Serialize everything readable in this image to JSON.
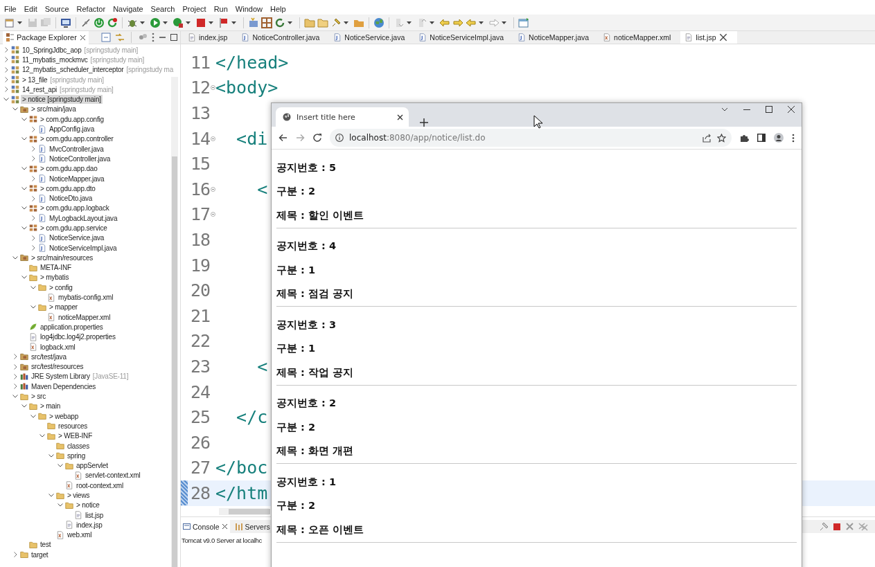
{
  "menu": [
    "File",
    "Edit",
    "Source",
    "Refactor",
    "Navigate",
    "Search",
    "Project",
    "Run",
    "Window",
    "Help"
  ],
  "package_explorer": {
    "title": "Package Explorer",
    "items": [
      {
        "label": "10_SpringJdbc_aop",
        "tag": "[springstudy main]",
        "kind": "project",
        "expanded": false,
        "selected": false
      },
      {
        "label": "11_mybatis_mockmvc",
        "tag": "[springstudy main]",
        "kind": "project",
        "expanded": false,
        "selected": false
      },
      {
        "label": "12_mybatis_scheduler_interceptor",
        "tag": "[springstudy ma",
        "kind": "project",
        "expanded": false,
        "selected": false
      },
      {
        "label": "> 13_file",
        "tag": "[springstudy main]",
        "kind": "project",
        "expanded": false,
        "selected": false
      },
      {
        "label": "14_rest_api",
        "tag": "[springstudy main]",
        "kind": "project",
        "expanded": false,
        "selected": false
      },
      {
        "label": "> notice [springstudy main]",
        "kind": "project",
        "expanded": true,
        "selected": true,
        "children": [
          {
            "label": "> src/main/java",
            "kind": "srcfolder",
            "expanded": true,
            "selected": false,
            "children": [
              {
                "label": "> com.gdu.app.config",
                "kind": "package",
                "expanded": true,
                "selected": false,
                "children": [
                  {
                    "label": "AppConfig.java",
                    "kind": "java",
                    "expanded": false,
                    "selected": false
                  }
                ]
              },
              {
                "label": "> com.gdu.app.controller",
                "kind": "package",
                "expanded": true,
                "selected": false,
                "children": [
                  {
                    "label": "MvcController.java",
                    "kind": "java",
                    "expanded": false,
                    "selected": false
                  },
                  {
                    "label": "NoticeController.java",
                    "kind": "java",
                    "expanded": false,
                    "selected": false
                  }
                ]
              },
              {
                "label": "> com.gdu.app.dao",
                "kind": "package",
                "expanded": true,
                "selected": false,
                "children": [
                  {
                    "label": "NoticeMapper.java",
                    "kind": "java",
                    "expanded": false,
                    "selected": false
                  }
                ]
              },
              {
                "label": "> com.gdu.app.dto",
                "kind": "package",
                "expanded": true,
                "selected": false,
                "children": [
                  {
                    "label": "NoticeDto.java",
                    "kind": "java",
                    "expanded": false,
                    "selected": false
                  }
                ]
              },
              {
                "label": "> com.gdu.app.logback",
                "kind": "package",
                "expanded": true,
                "selected": false,
                "children": [
                  {
                    "label": "MyLogbackLayout.java",
                    "kind": "java",
                    "expanded": false,
                    "selected": false
                  }
                ]
              },
              {
                "label": "> com.gdu.app.service",
                "kind": "package",
                "expanded": true,
                "selected": false,
                "children": [
                  {
                    "label": "NoticeService.java",
                    "kind": "java",
                    "expanded": false,
                    "selected": false
                  },
                  {
                    "label": "NoticeServiceImpl.java",
                    "kind": "java",
                    "expanded": false,
                    "selected": false
                  }
                ]
              }
            ]
          },
          {
            "label": "> src/main/resources",
            "kind": "srcfolder",
            "expanded": true,
            "selected": false,
            "children": [
              {
                "label": "META-INF",
                "kind": "folder",
                "selected": false
              },
              {
                "label": "> mybatis",
                "kind": "folder",
                "expanded": true,
                "selected": false,
                "children": [
                  {
                    "label": "> config",
                    "kind": "folder",
                    "expanded": true,
                    "selected": false,
                    "children": [
                      {
                        "label": "mybatis-config.xml",
                        "kind": "xml",
                        "selected": false
                      }
                    ]
                  },
                  {
                    "label": "> mapper",
                    "kind": "folder",
                    "expanded": true,
                    "selected": false,
                    "children": [
                      {
                        "label": "noticeMapper.xml",
                        "kind": "xml",
                        "selected": false
                      }
                    ]
                  }
                ]
              },
              {
                "label": "application.properties",
                "kind": "properties",
                "selected": false
              },
              {
                "label": "log4jdbc.log4j2.properties",
                "kind": "file",
                "selected": false
              },
              {
                "label": "logback.xml",
                "kind": "xml",
                "selected": false
              }
            ]
          },
          {
            "label": "src/test/java",
            "kind": "srcfolder",
            "expanded": false,
            "selected": false
          },
          {
            "label": "src/test/resources",
            "kind": "srcfolder",
            "expanded": false,
            "selected": false
          },
          {
            "label": "JRE System Library",
            "tag": "[JavaSE-11]",
            "kind": "library",
            "expanded": false,
            "selected": false
          },
          {
            "label": "Maven Dependencies",
            "kind": "library",
            "expanded": false,
            "selected": false
          },
          {
            "label": "> src",
            "kind": "folder",
            "expanded": true,
            "selected": false,
            "children": [
              {
                "label": "> main",
                "kind": "folder",
                "expanded": true,
                "selected": false,
                "children": [
                  {
                    "label": "> webapp",
                    "kind": "folder",
                    "expanded": true,
                    "selected": false,
                    "children": [
                      {
                        "label": "resources",
                        "kind": "folder",
                        "selected": false
                      },
                      {
                        "label": "> WEB-INF",
                        "kind": "folder",
                        "expanded": true,
                        "selected": false,
                        "children": [
                          {
                            "label": "classes",
                            "kind": "folder",
                            "selected": false
                          },
                          {
                            "label": "spring",
                            "kind": "folder",
                            "expanded": true,
                            "selected": false,
                            "children": [
                              {
                                "label": "appServlet",
                                "kind": "folder",
                                "expanded": true,
                                "selected": false,
                                "children": [
                                  {
                                    "label": "servlet-context.xml",
                                    "kind": "xml",
                                    "selected": false
                                  }
                                ]
                              },
                              {
                                "label": "root-context.xml",
                                "kind": "xml",
                                "selected": false
                              }
                            ]
                          },
                          {
                            "label": "> views",
                            "kind": "folder",
                            "expanded": true,
                            "selected": false,
                            "children": [
                              {
                                "label": "> notice",
                                "kind": "folder",
                                "expanded": true,
                                "selected": false,
                                "children": [
                                  {
                                    "label": "list.jsp",
                                    "kind": "file",
                                    "selected": false
                                  }
                                ]
                              },
                              {
                                "label": "index.jsp",
                                "kind": "file",
                                "selected": false
                              }
                            ]
                          },
                          {
                            "label": "web.xml",
                            "kind": "xml",
                            "selected": false
                          }
                        ]
                      }
                    ]
                  }
                ]
              },
              {
                "label": "test",
                "kind": "folder",
                "selected": false
              }
            ]
          },
          {
            "label": "target",
            "kind": "folder",
            "expanded": false,
            "selected": false
          }
        ]
      }
    ]
  },
  "editor": {
    "tabs": [
      {
        "label": "index.jsp",
        "kind": "file",
        "selected": false
      },
      {
        "label": "NoticeController.java",
        "kind": "java",
        "selected": false
      },
      {
        "label": "NoticeService.java",
        "kind": "java",
        "selected": false
      },
      {
        "label": "NoticeServiceImpl.java",
        "kind": "java",
        "selected": false
      },
      {
        "label": "NoticeMapper.java",
        "kind": "java",
        "selected": false
      },
      {
        "label": "noticeMapper.xml",
        "kind": "xml",
        "selected": false
      },
      {
        "label": "list.jsp",
        "kind": "file",
        "selected": true
      }
    ],
    "lines": [
      {
        "number": "11",
        "code": "</head>",
        "fold": false,
        "current": false
      },
      {
        "number": "12",
        "code": "<body>",
        "fold": true,
        "current": false
      },
      {
        "number": "13",
        "fold": false,
        "current": false
      },
      {
        "number": "14",
        "code": "  <di",
        "fold": true,
        "current": false
      },
      {
        "number": "15",
        "fold": false,
        "current": false
      },
      {
        "number": "16",
        "code": "    <",
        "fold": true,
        "current": false
      },
      {
        "number": "17",
        "fold": true,
        "current": false
      },
      {
        "number": "18",
        "fold": false,
        "current": false
      },
      {
        "number": "19",
        "fold": false,
        "current": false
      },
      {
        "number": "20",
        "fold": false,
        "current": false
      },
      {
        "number": "21",
        "fold": false,
        "current": false
      },
      {
        "number": "22",
        "fold": false,
        "current": false
      },
      {
        "number": "23",
        "code": "    <",
        "fold": false,
        "current": false
      },
      {
        "number": "24",
        "fold": false,
        "current": false
      },
      {
        "number": "25",
        "code": "  </c",
        "fold": false,
        "current": false
      },
      {
        "number": "26",
        "fold": false,
        "current": false
      },
      {
        "number": "27",
        "code": "</boc",
        "fold": false,
        "current": false
      },
      {
        "number": "28",
        "code": "</htm",
        "fold": false,
        "current": true
      }
    ]
  },
  "bottom_panel": {
    "tabs": [
      {
        "label": "Console",
        "selected": true
      },
      {
        "label": "Servers",
        "selected": false
      }
    ],
    "text": "Tomcat v9.0 Server at localhc"
  },
  "browser": {
    "tab_title": "Insert title here",
    "url_host": "localhost",
    "url_path": ":8080/app/notice/list.do",
    "notices": [
      {
        "lines": [
          "공지번호 : 5",
          "구분 : 2",
          "제목 : 할인 이벤트"
        ]
      },
      {
        "lines": [
          "공지번호 : 4",
          "구분 : 1",
          "제목 : 점검 공지"
        ]
      },
      {
        "lines": [
          "공지번호 : 3",
          "구분 : 1",
          "제목 : 작업 공지"
        ]
      },
      {
        "lines": [
          "공지번호 : 2",
          "구분 : 2",
          "제목 : 화면 개편"
        ]
      },
      {
        "lines": [
          "공지번호 : 1",
          "구분 : 2",
          "제목 : 오픈 이벤트"
        ]
      }
    ]
  }
}
